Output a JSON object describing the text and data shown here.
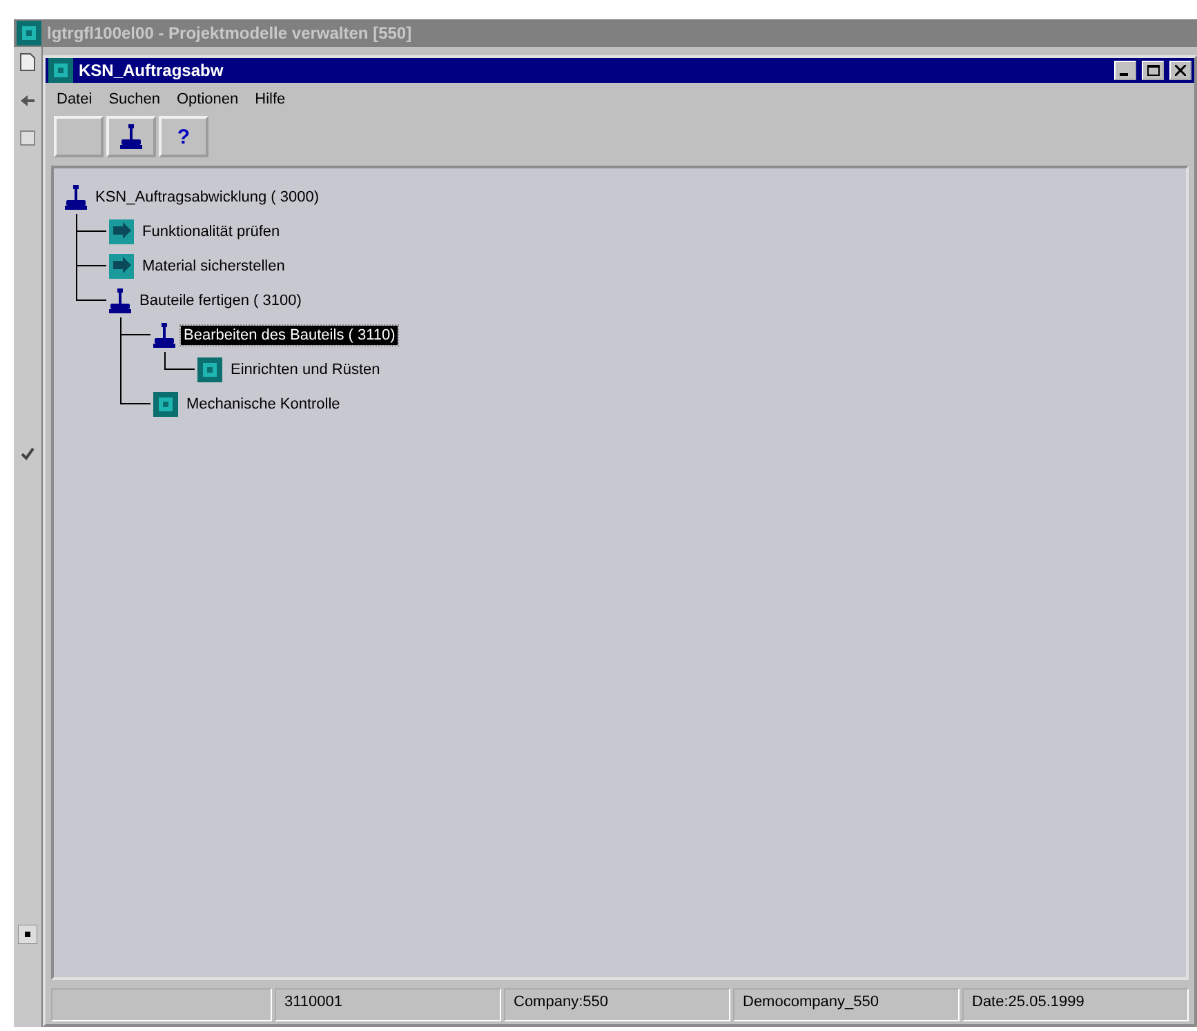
{
  "outer_window": {
    "title": "lgtrgfl100el00 - Projektmodelle verwalten [550]"
  },
  "window": {
    "title": "KSN_Auftragsabw"
  },
  "menu": [
    "Datei",
    "Suchen",
    "Optionen",
    "Hilfe"
  ],
  "toolbar": [
    {
      "kind": "blank"
    },
    {
      "kind": "stamp"
    },
    {
      "kind": "help",
      "label": "?"
    }
  ],
  "tree": [
    {
      "label": "KSN_Auftragsabwicklung ( 3000)",
      "kind": "group",
      "selected": false,
      "children": [
        {
          "label": "Funktionalität prüfen",
          "kind": "task",
          "selected": false
        },
        {
          "label": "Material sicherstellen",
          "kind": "task",
          "selected": false
        },
        {
          "label": "Bauteile fertigen ( 3100)",
          "kind": "group",
          "selected": false,
          "children": [
            {
              "label": "Bearbeiten des Bauteils ( 3110)",
              "kind": "group",
              "selected": true,
              "children": [
                {
                  "label": "Einrichten und Rüsten",
                  "kind": "step",
                  "selected": false
                }
              ]
            },
            {
              "label": "Mechanische Kontrolle",
              "kind": "step",
              "selected": false
            }
          ]
        }
      ]
    }
  ],
  "status_bar": [
    "3110001",
    "Company:550",
    "Democompany_550",
    "Date:25.05.1999"
  ]
}
